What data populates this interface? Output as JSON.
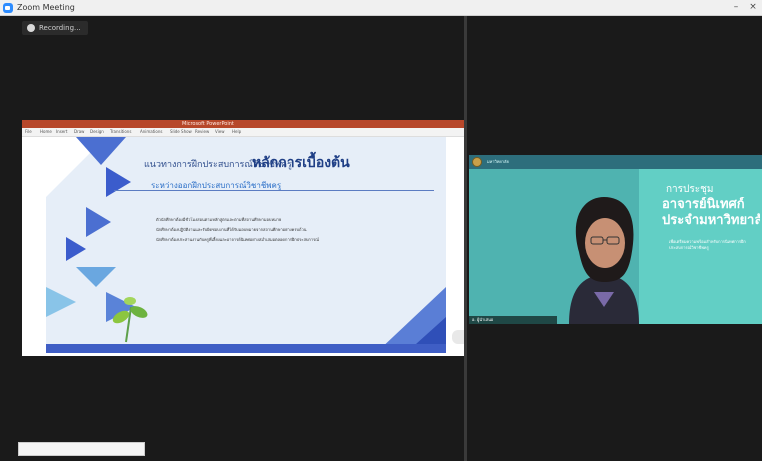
{
  "window": {
    "title": "Zoom Meeting",
    "minimize": "–",
    "close": "×"
  },
  "recording": {
    "label": "Recording..."
  },
  "shared_screen": {
    "app_title": "Microsoft PowerPoint",
    "menu": [
      "File",
      "Home",
      "Insert",
      "Draw",
      "Design",
      "Transitions",
      "Animations",
      "Slide Show",
      "Review",
      "View",
      "Help"
    ],
    "slide": {
      "heading_small": "แนวทางการฝึกประสบการณ์วิชาชีพครู",
      "heading_large": "หลักการเบื้องต้น",
      "subheading": "ระหว่างออกฝึกประสบการณ์วิชาชีพครู",
      "bullets": [
        "ตัวนักศึกษาต้องมีชั่วโมงสอนตามหลักสูตรและตามที่สถานศึกษามอบหมาย",
        "นักศึกษาต้องปฏิบัติงานและรับผิดชอบงานที่ได้รับมอบหมายจากสถานศึกษาอย่างครบถ้วน",
        "นักศึกษาต้องประสานงานกับครูพี่เลี้ยงและอาจารย์นิเทศอย่างสม่ำเสมอตลอดการฝึกประสบการณ์"
      ]
    }
  },
  "video": {
    "org": "มหาวิทยาลัย",
    "meeting_label": "การประชุม",
    "topic_line1": "อาจารย์นิเทศก์",
    "topic_line2": "ประจำมหาวิทยาลัย",
    "info": "เพื่อเตรียมความพร้อมสำหรับการนิเทศการฝึกประสบการณ์วิชาชีพครู",
    "name": "อ. ผู้นำเสนอ"
  },
  "chat_input": {
    "value": ""
  },
  "colors": {
    "accent": "#2d8cff",
    "slide_blue": "#3f5ec5",
    "teal": "#4fb3b0"
  }
}
